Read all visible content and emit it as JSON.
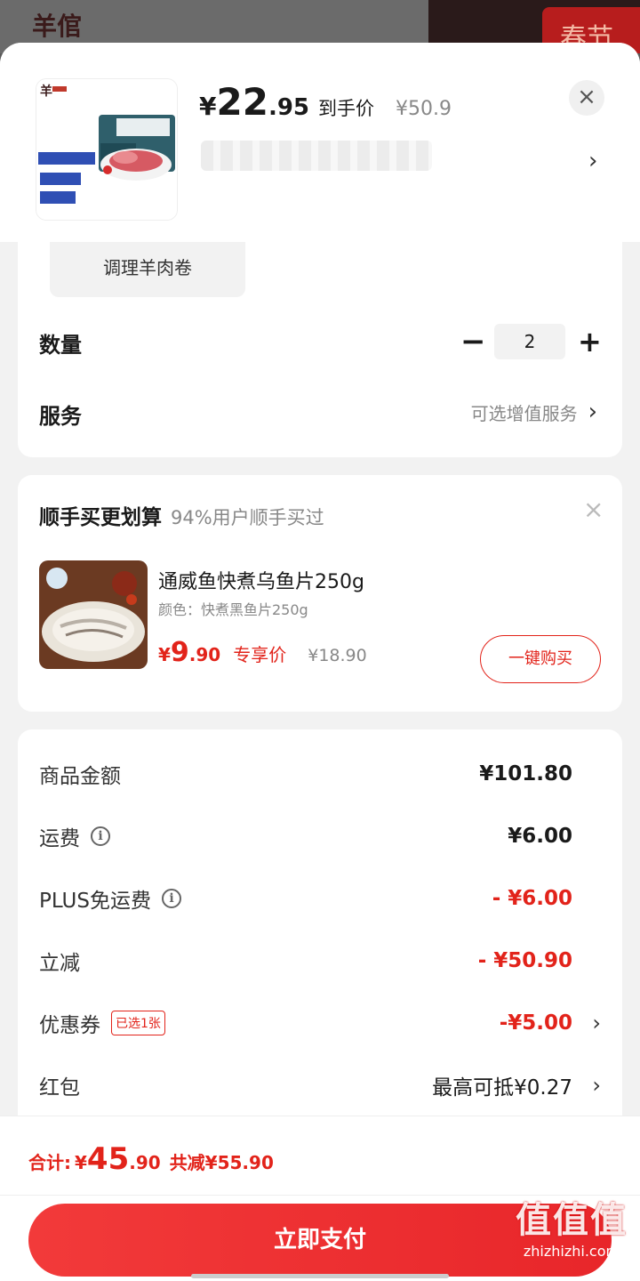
{
  "backdrop": {
    "logo_text": "羊倌",
    "banner_text": "春节"
  },
  "product": {
    "currency": "¥",
    "price_int": "22",
    "price_dec": ".95",
    "price_tag": "到手价",
    "original_price": "¥50.9",
    "spec_selected": "调理羊肉卷"
  },
  "quantity": {
    "label": "数量",
    "value": "2",
    "minus": "−",
    "plus": "+"
  },
  "service": {
    "label": "服务",
    "value": "可选增值服务"
  },
  "upsell": {
    "title": "顺手买更划算",
    "subtitle": "94%用户顺手买过",
    "item_name": "通威鱼快煮乌鱼片250g",
    "item_color": "颜色：快煮黑鱼片250g",
    "currency": "¥",
    "price_int": "9",
    "price_dec": ".90",
    "price_label": "专享价",
    "original_price": "¥18.90",
    "buy_label": "一键购买"
  },
  "totals": {
    "goods_label": "商品金额",
    "goods_value": "¥101.80",
    "shipping_label": "运费",
    "shipping_value": "¥6.00",
    "plus_label": "PLUS免运费",
    "plus_value": "- ¥6.00",
    "discount_label": "立减",
    "discount_value": "- ¥50.90",
    "coupon_label": "优惠券",
    "coupon_badge": "已选1张",
    "coupon_value": "-¥5.00",
    "redpacket_label": "红包",
    "redpacket_value": "最高可抵¥0.27"
  },
  "summary": {
    "label": "合计:",
    "currency": "¥",
    "total_int": "45",
    "total_dec": ".90",
    "saved": "共减¥55.90",
    "pay_label": "立即支付"
  },
  "watermark": {
    "big": "值值值",
    "small": "zhizhizhi.com"
  },
  "colors": {
    "accent": "#e2231a",
    "background": "#f2f2f2"
  }
}
